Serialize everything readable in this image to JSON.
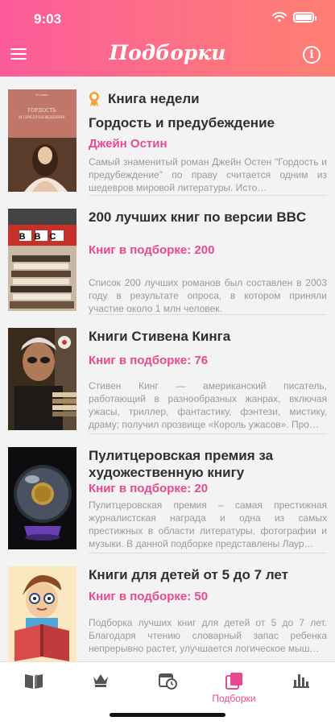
{
  "status": {
    "time": "9:03"
  },
  "header": {
    "title": "Подборки"
  },
  "colors": {
    "accent": "#e94a8f",
    "header_from": "#fb5b9a",
    "header_to": "#ff7f73"
  },
  "collections": [
    {
      "badge": "Книга недели",
      "title": "Гордость и предубеждение",
      "author": "Джейн Остин",
      "description": "Самый знаменитый роман Джейн Остен \"Гордость и предубеждение\" по праву считается одним из шедевров мировой литературы. Исто…",
      "cover_icon": "pride-and-prejudice-cover"
    },
    {
      "title": "200 лучших книг по версии BBC",
      "count": "Книг в подборке: 200",
      "description": "Список 200 лучших романов  был составлен в 2003 году в результате опроса, в котором приняли участие около 1 млн человек.",
      "cover_icon": "bbc-books-cover",
      "cover_text": "BBC"
    },
    {
      "title": "Книги Стивена Кинга",
      "count": "Книг в подборке: 76",
      "description": "Стивен Кинг — американский писатель, работающий в разнообразных жанрах, включая ужасы, триллер, фантастику, фэнтези, мистику, драму; получил прозвище «Король ужасов». Про…",
      "cover_icon": "stephen-king-cover"
    },
    {
      "title": "Пулитцеровская премия за художественную книгу",
      "count": "Книг в подборке: 20",
      "description": "Пулитцеровская премия – самая престижная журналистская награда и одна из самых престижных в области литературы, фотографии и музыки. В данной подборке представлены Лаур…",
      "cover_icon": "pulitzer-crystal-ball-cover"
    },
    {
      "title": "Книги для детей от 5 до 7 лет",
      "count": "Книг в подборке: 50",
      "description": "Подборка лучших книг для детей от 5 до 7 лет. Благодаря чтению словарный запас ребенка непрерывно растет, улучшается логическое мыш…",
      "cover_icon": "kid-reading-cover"
    }
  ],
  "tabbar": {
    "items": [
      {
        "icon": "open-book-icon"
      },
      {
        "icon": "crown-icon"
      },
      {
        "icon": "calendar-clock-icon"
      },
      {
        "icon": "collections-icon",
        "label": "Подборки",
        "active": true
      },
      {
        "icon": "bar-chart-icon"
      }
    ]
  }
}
